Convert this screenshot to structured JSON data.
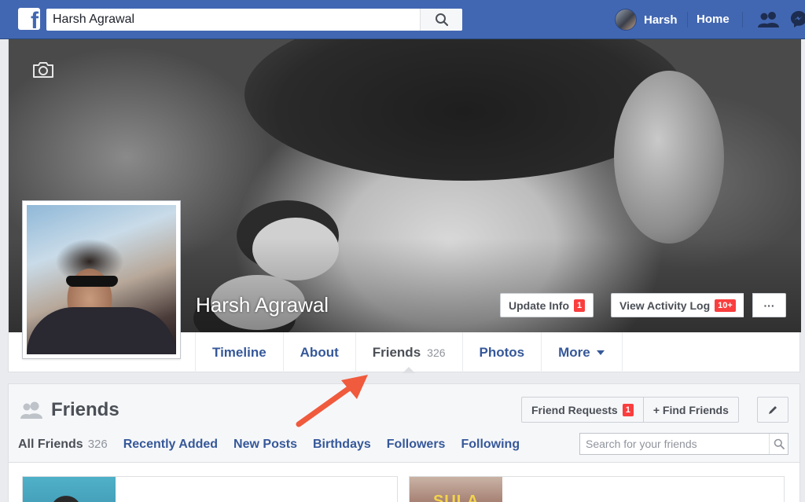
{
  "topbar": {
    "search_value": "Harsh Agrawal",
    "user_name": "Harsh",
    "home_label": "Home",
    "logo_letter": "f"
  },
  "profile": {
    "name": "Harsh Agrawal",
    "update_info_label": "Update Info",
    "update_info_badge": "1",
    "view_log_label": "View Activity Log",
    "view_log_badge": "10+",
    "more_label": "···"
  },
  "tabs": [
    {
      "label": "Timeline"
    },
    {
      "label": "About"
    },
    {
      "label": "Friends",
      "count": "326"
    },
    {
      "label": "Photos"
    },
    {
      "label": "More"
    }
  ],
  "friends_section": {
    "title": "Friends",
    "friend_requests_label": "Friend Requests",
    "friend_requests_badge": "1",
    "find_friends_label": "+ Find Friends",
    "subtabs": [
      {
        "label": "All Friends",
        "count": "326"
      },
      {
        "label": "Recently Added"
      },
      {
        "label": "New Posts"
      },
      {
        "label": "Birthdays"
      },
      {
        "label": "Followers"
      },
      {
        "label": "Following"
      }
    ],
    "search_placeholder": "Search for your friends",
    "tile_2_text": "SULA"
  },
  "colors": {
    "brand": "#4267b2",
    "link": "#365899",
    "badge": "#fa3e3e",
    "annotation_arrow": "#f05a3d"
  },
  "icons": [
    "facebook-logo",
    "search-icon",
    "friends-icon",
    "messenger-icon",
    "camera-icon",
    "pencil-icon",
    "caret-down-icon",
    "annotation-arrow"
  ]
}
